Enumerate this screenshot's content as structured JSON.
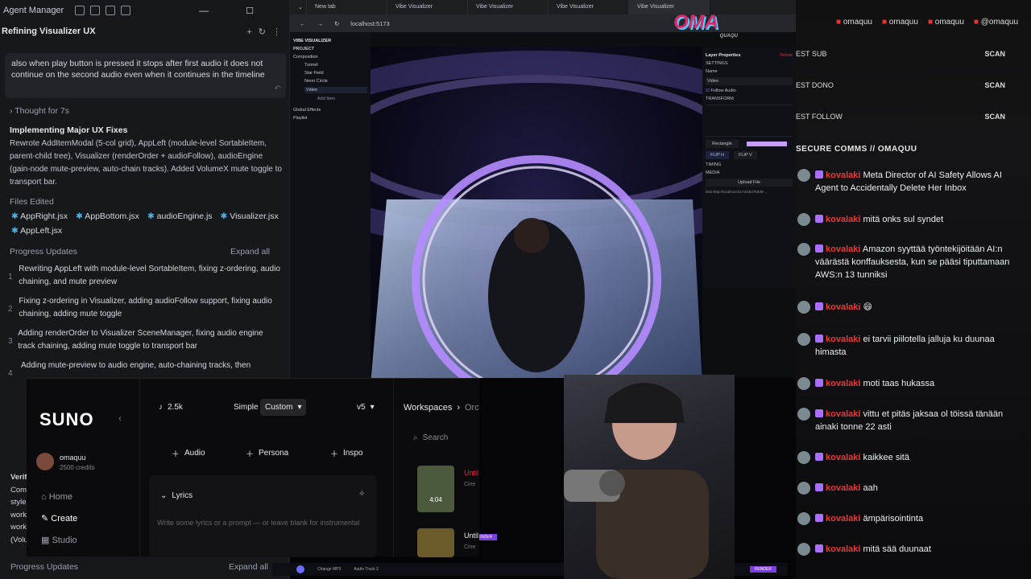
{
  "agent": {
    "title": "Agent Manager",
    "thread": "Refining Visualizer UX",
    "message": "also when play button is pressed it stops after first audio it does not continue on the second audio even when it continues in the timeline",
    "thought": "Thought for 7s",
    "heading": "Implementing Major UX Fixes",
    "summary": "Rewrote AddItemModal (5-col grid), AppLeft (module-level SortableItem, parent-child tree), Visualizer (renderOrder + audioFollow), audioEngine (gain-node mute-preview, auto-chain tracks). Added VolumeX mute toggle to transport bar.",
    "files_label": "Files Edited",
    "files": [
      "AppRight.jsx",
      "AppBottom.jsx",
      "audioEngine.js",
      "Visualizer.jsx",
      "AppLeft.jsx"
    ],
    "progress_label": "Progress Updates",
    "expand": "Expand all",
    "updates": [
      {
        "n": "1",
        "text": "Rewriting AppLeft with module-level SortableItem, fixing z-ordering, audio chaining, and mute preview"
      },
      {
        "n": "2",
        "text": "Fixing z-ordering in Visualizer, adding audioFollow support, fixing audio chaining, adding mute toggle"
      },
      {
        "n": "3",
        "text": "Adding renderOrder to Visualizer SceneManager, fixing audio engine track chaining, adding mute toggle to transport bar"
      },
      {
        "n": "4",
        "text": "Adding mute-preview to audio engine, auto-chaining tracks, then"
      }
    ],
    "footer_progress": "Progress Updates",
    "footer_expand": "Expand all",
    "side_fragments": [
      "Verif",
      "Com",
      "style",
      "work",
      "work",
      "(Volu"
    ]
  },
  "browser": {
    "tabs": [
      "New tab",
      "Vibe Visualizer",
      "Vibe Visualizer",
      "Vibe Visualizer",
      "Vibe Visualizer"
    ],
    "url": "localhost:5173",
    "app_name": "VIBE VISUALIZER",
    "project": "PROJECT",
    "tree": [
      "Composition",
      "Tunnel",
      "Star Field",
      "Neon Circle",
      "Video",
      "Add Item",
      "Global Effects",
      "Playlist"
    ],
    "layer_props": "Layer Properties",
    "delete": "Delete",
    "settings": "SETTINGS",
    "name_label": "Name",
    "name_value": "Video",
    "follow_audio": "Follow Audio",
    "transform": "TRANSFORM",
    "shape": "Rectangle",
    "flip_h": "FLIP H",
    "flip_v": "FLIP V",
    "timing": "TIMING",
    "media": "MEDIA",
    "upload": "Upload File",
    "blob": "blob:http://localhost:5173/4b47b0d9-...",
    "render": "RENDER",
    "change_mp3": "Change MP3",
    "audio_track": "Audio Track 2"
  },
  "suno": {
    "logo": "SUNO",
    "user": "omaquu",
    "credits": "2500 credits",
    "nav": [
      "Home",
      "Create",
      "Studio"
    ],
    "count": "2.5k",
    "mode_simple": "Simple",
    "mode_custom": "Custom",
    "version": "v5",
    "buttons": [
      "Audio",
      "Persona",
      "Inspo"
    ],
    "lyrics": "Lyrics",
    "lyrics_placeholder": "Write some lyrics or a prompt — or leave blank for instrumental",
    "workspaces": "Workspaces",
    "workspaces_tail": "Orc",
    "search": "Search",
    "song1": "Until",
    "song1_sub": "Cine",
    "song1_time": "4:04",
    "song2": "Until",
    "song2_sub": "Cine"
  },
  "overlay": {
    "logo": "OMA",
    "logo_sub": "QUAQU"
  },
  "chat": {
    "socials": [
      "omaquu",
      "omaquu",
      "omaquu",
      "@omaquu"
    ],
    "events": [
      {
        "label": "EST SUB",
        "tag": "SCAN"
      },
      {
        "label": "EST DONO",
        "tag": "SCAN"
      },
      {
        "label": "EST FOLLOW",
        "tag": "SCAN"
      }
    ],
    "header": "SECURE COMMS // OMAQUU",
    "messages": [
      {
        "user": "kovalaki",
        "text": "Meta Director of AI Safety Allows AI Agent to Accidentally Delete Her Inbox"
      },
      {
        "user": "kovalaki",
        "text": "mitä onks sul syndet"
      },
      {
        "user": "kovalaki",
        "text": "Amazon syyttää työntekijöitään AI:n väärästä konffauksesta, kun se pääsi tiputtamaan AWS:n 13 tunniksi"
      },
      {
        "user": "kovalaki",
        "text": "😄"
      },
      {
        "user": "kovalaki",
        "text": "ei tarvii piilotella jalluja ku duunaa himasta"
      },
      {
        "user": "kovalaki",
        "text": "moti taas hukassa"
      },
      {
        "user": "kovalaki",
        "text": "vittu et pitäs jaksaa ol töissä tänään ainaki tonne 22 asti"
      },
      {
        "user": "kovalaki",
        "text": "kaikkee sitä"
      },
      {
        "user": "kovalaki",
        "text": "aah"
      },
      {
        "user": "kovalaki",
        "text": "ämpärisointinta"
      },
      {
        "user": "kovalaki",
        "text": "mitä sää duunaat"
      }
    ]
  },
  "colors": {
    "accent": "#a970ff",
    "user": "#e53a3a",
    "chat_header": "#e6e6e6"
  }
}
